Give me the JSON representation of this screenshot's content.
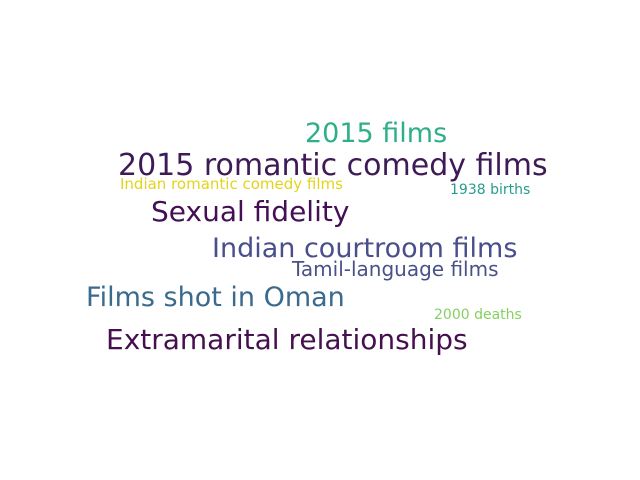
{
  "words": [
    {
      "text": "2015 films",
      "color": "#2fae8a"
    },
    {
      "text": "2015 romantic comedy films",
      "color": "#3e1a57"
    },
    {
      "text": "Indian romantic comedy films",
      "color": "#e3d41b"
    },
    {
      "text": "1938 births",
      "color": "#279c8c"
    },
    {
      "text": "Sexual fidelity",
      "color": "#450f55"
    },
    {
      "text": "Indian courtroom films",
      "color": "#4a4f8c"
    },
    {
      "text": "Tamil-language films",
      "color": "#4a5189"
    },
    {
      "text": "Films shot in Oman",
      "color": "#3a6a8d"
    },
    {
      "text": "2000 deaths",
      "color": "#86d062"
    },
    {
      "text": "Extramarital relationships",
      "color": "#46104f"
    }
  ]
}
